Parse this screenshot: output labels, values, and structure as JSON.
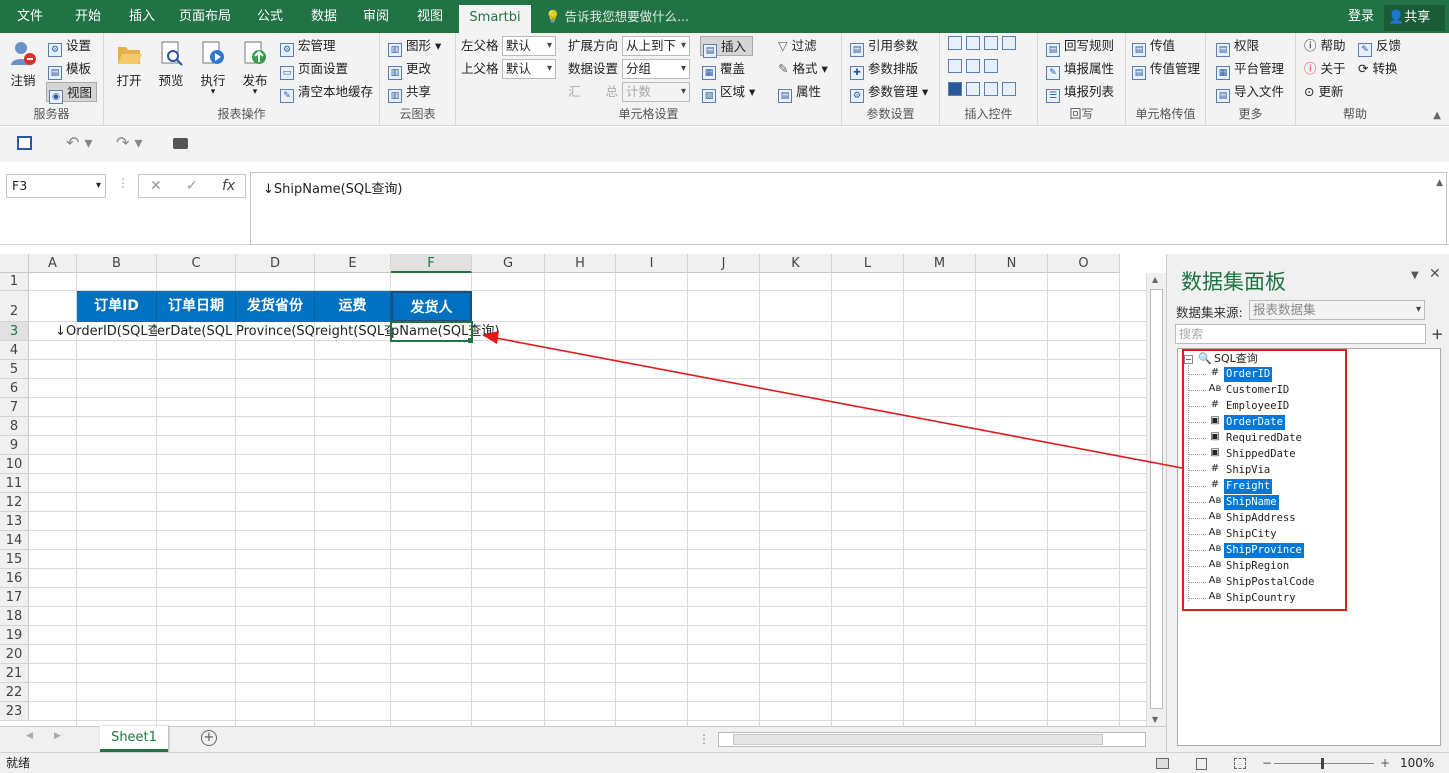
{
  "menu_tabs": [
    "文件",
    "开始",
    "插入",
    "页面布局",
    "公式",
    "数据",
    "审阅",
    "视图",
    "Smartbi"
  ],
  "tell_me": "告诉我您想要做什么...",
  "login": "登录",
  "share": "共享",
  "ribbon": {
    "server": {
      "label": "服务器",
      "logout": "注销",
      "settings": "设置",
      "template": "模板",
      "view": "视图"
    },
    "report_ops": {
      "label": "报表操作",
      "open": "打开",
      "preview": "预览",
      "execute": "执行",
      "publish": "发布",
      "macro": "宏管理",
      "page_setup": "页面设置",
      "clear_cache": "清空本地缓存"
    },
    "cloud": {
      "label": "云图表",
      "chart": "图形",
      "change": "更改",
      "share": "共享"
    },
    "cell_settings": {
      "label": "单元格设置",
      "left_parent": "左父格",
      "top_parent": "上父格",
      "left_val": "默认",
      "top_val": "默认",
      "expand_dir": "扩展方向",
      "expand_val": "从上到下",
      "data_setting": "数据设置",
      "data_val": "分组",
      "summary": "汇　　总",
      "summary_val": "计数",
      "insert": "插入",
      "cover": "覆盖",
      "region": "区域"
    },
    "filter": {
      "filter": "过滤",
      "format": "格式",
      "property": "属性"
    },
    "params": {
      "label": "参数设置",
      "ref": "引用参数",
      "layout": "参数排版",
      "manage": "参数管理"
    },
    "controls": {
      "label": "插入控件"
    },
    "writeback": {
      "label": "回写",
      "rule": "回写规则",
      "fill_prop": "填报属性",
      "fill_list": "填报列表"
    },
    "cellpass": {
      "label": "单元格传值",
      "pass": "传值",
      "pass_mgr": "传值管理"
    },
    "more": {
      "label": "更多",
      "perm": "权限",
      "platform": "平台管理",
      "import": "导入文件"
    },
    "help": {
      "label": "帮助",
      "help": "帮助",
      "about": "关于",
      "update": "更新",
      "feedback": "反馈",
      "convert": "转换"
    }
  },
  "name_box": "F3",
  "formula": "↓ShipName(SQL查询)",
  "columns": [
    "A",
    "B",
    "C",
    "D",
    "E",
    "F",
    "G",
    "H",
    "I",
    "J",
    "K",
    "L",
    "M",
    "N",
    "O"
  ],
  "rows": [
    "1",
    "2",
    "3",
    "4",
    "5",
    "6",
    "7",
    "8",
    "9",
    "10",
    "11",
    "12",
    "13",
    "14",
    "15",
    "16",
    "17",
    "18",
    "19",
    "20",
    "21",
    "22",
    "23"
  ],
  "header_row": [
    "订单ID",
    "订单日期",
    "发货省份",
    "运费",
    "发货人"
  ],
  "data_row": [
    "↓",
    "OrderID(SQL查",
    "erDate(SQL",
    "Province(SQ",
    "reight(SQL查",
    "pName(SQL查询)"
  ],
  "sheet_tab": "Sheet1",
  "status": "就绪",
  "zoom": "100%",
  "panel": {
    "title": "数据集面板",
    "source_label": "数据集来源:",
    "source_value": "报表数据集",
    "search_placeholder": "搜索",
    "root": "SQL查询",
    "fields": [
      {
        "name": "OrderID",
        "type": "#",
        "hl": true
      },
      {
        "name": "CustomerID",
        "type": "Ab",
        "hl": false
      },
      {
        "name": "EmployeeID",
        "type": "#",
        "hl": false
      },
      {
        "name": "OrderDate",
        "type": "date",
        "hl": true
      },
      {
        "name": "RequiredDate",
        "type": "date",
        "hl": false
      },
      {
        "name": "ShippedDate",
        "type": "date",
        "hl": false
      },
      {
        "name": "ShipVia",
        "type": "#",
        "hl": false
      },
      {
        "name": "Freight",
        "type": "#",
        "hl": true
      },
      {
        "name": "ShipName",
        "type": "Ab",
        "hl": true
      },
      {
        "name": "ShipAddress",
        "type": "Ab",
        "hl": false
      },
      {
        "name": "ShipCity",
        "type": "Ab",
        "hl": false
      },
      {
        "name": "ShipProvince",
        "type": "Ab",
        "hl": true
      },
      {
        "name": "ShipRegion",
        "type": "Ab",
        "hl": false
      },
      {
        "name": "ShipPostalCode",
        "type": "Ab",
        "hl": false
      },
      {
        "name": "ShipCountry",
        "type": "Ab",
        "hl": false
      }
    ]
  },
  "colors": {
    "excel_green": "#217346",
    "header_blue": "#0070c0",
    "highlight": "#0078d7",
    "annotation_red": "#e11a1a"
  }
}
